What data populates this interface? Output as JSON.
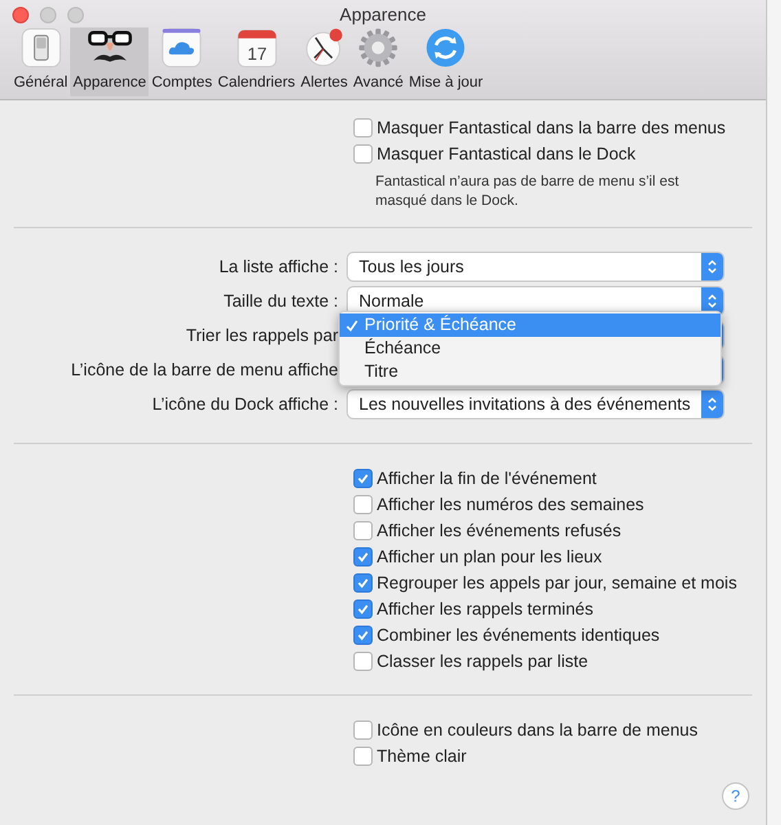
{
  "window": {
    "title": "Apparence"
  },
  "toolbar": [
    {
      "label": "Général",
      "selected": false
    },
    {
      "label": "Apparence",
      "selected": true
    },
    {
      "label": "Comptes",
      "selected": false
    },
    {
      "label": "Calendriers",
      "selected": false,
      "badge": "17"
    },
    {
      "label": "Alertes",
      "selected": false
    },
    {
      "label": "Avancé",
      "selected": false
    },
    {
      "label": "Mise à jour",
      "selected": false
    }
  ],
  "hide_options": [
    {
      "label": "Masquer Fantastical dans la barre des menus",
      "checked": false
    },
    {
      "label": "Masquer Fantastical dans le Dock",
      "checked": false
    }
  ],
  "hide_note": "Fantastical n’aura pas de barre de menu s’il est masqué dans le Dock.",
  "popups": [
    {
      "label": "La liste affiche :",
      "value": "Tous les jours"
    },
    {
      "label": "Taille du texte :",
      "value": "Normale"
    },
    {
      "label": "Trier les rappels par",
      "open_menu": [
        {
          "label": "Priorité & Échéance",
          "selected": true
        },
        {
          "label": "Échéance",
          "selected": false
        },
        {
          "label": "Titre",
          "selected": false
        }
      ]
    },
    {
      "label": "L’icône de la barre de menu affiche"
    },
    {
      "label": "L’icône du Dock affiche :",
      "value": "Les nouvelles invitations à des événements"
    }
  ],
  "display_options": [
    {
      "label": "Afficher la fin de l'événement",
      "checked": true
    },
    {
      "label": "Afficher les numéros des semaines",
      "checked": false
    },
    {
      "label": "Afficher les événements refusés",
      "checked": false
    },
    {
      "label": "Afficher un plan pour les lieux",
      "checked": true
    },
    {
      "label": "Regrouper les appels par jour, semaine et mois",
      "checked": true
    },
    {
      "label": "Afficher les rappels terminés",
      "checked": true
    },
    {
      "label": "Combiner les événements identiques",
      "checked": true
    },
    {
      "label": "Classer les rappels par liste",
      "checked": false
    }
  ],
  "appearance_options": [
    {
      "label": "Icône en couleurs dans la barre de menus",
      "checked": false
    },
    {
      "label": "Thème clair",
      "checked": false
    }
  ],
  "help_button": "?"
}
